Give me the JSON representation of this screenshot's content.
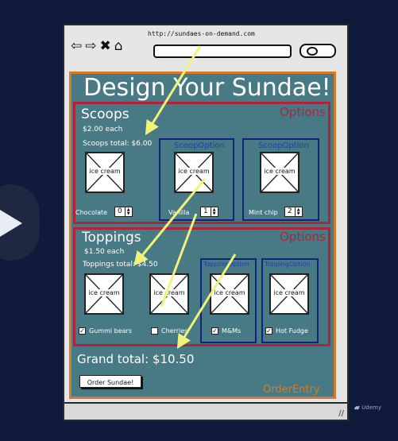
{
  "browser": {
    "url": "http://sundaes-on-demand.com",
    "nav_icons": [
      "back-arrow-icon",
      "forward-arrow-icon",
      "close-icon",
      "home-icon"
    ]
  },
  "page": {
    "title": "Design Your Sundae!"
  },
  "scoops": {
    "title": "Scoops",
    "options_label": "Options",
    "price_each": "$2.00 each",
    "total": "Scoops total: $6.00",
    "option_component_label": "ScoopOption",
    "items": [
      {
        "image_text": "ice cream",
        "name": "Chocolate",
        "qty": "0"
      },
      {
        "image_text": "ice cream",
        "name": "Vanilla",
        "qty": "1"
      },
      {
        "image_text": "ice cream",
        "name": "Mint chip",
        "qty": "2"
      }
    ]
  },
  "toppings": {
    "title": "Toppings",
    "options_label": "Options",
    "price_each": "$1.50 each",
    "total": "Toppings total: $4.50",
    "option_component_label": "ToppingOption",
    "items": [
      {
        "image_text": "ice cream",
        "name": "Gummi bears",
        "checked": true
      },
      {
        "image_text": "ice cream",
        "name": "Cherries",
        "checked": false
      },
      {
        "image_text": "ice cream",
        "name": "M&Ms",
        "checked": true
      },
      {
        "image_text": "ice cream",
        "name": "Hot Fudge",
        "checked": true
      }
    ]
  },
  "grand_total": "Grand total: $10.50",
  "order_button": "Order Sundae!",
  "order_entry_label": "OrderEntry",
  "branding": {
    "udemy": "Udemy"
  },
  "colors": {
    "background": "#0f1a3c",
    "order_entry_border": "#d57a2a",
    "section_border": "#b0243a",
    "option_border": "#12237a",
    "panel_fill": "#477a84",
    "arrow": "#f2f27a"
  }
}
